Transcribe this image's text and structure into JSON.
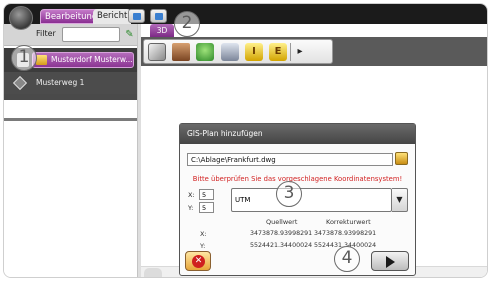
{
  "tabs": {
    "active": "Bearbeitung",
    "other": "Bericht"
  },
  "left_panel": {
    "filter_label": "Filter",
    "filter_value": "",
    "tree_items": [
      {
        "label": "Musterdorf Musterw..."
      },
      {
        "label": "Musterweg 1"
      }
    ]
  },
  "toolbar": {
    "view_tab_label": "3D",
    "buttons": [
      {
        "icon": "cube-icon"
      },
      {
        "icon": "layers-icon"
      },
      {
        "icon": "leaf-icon"
      },
      {
        "icon": "gray-stack-icon"
      },
      {
        "icon": "i-icon",
        "text": "I"
      },
      {
        "icon": "e-icon",
        "text": "E"
      }
    ],
    "more_arrow": "▸"
  },
  "dialog": {
    "title": "GIS-Plan hinzufügen",
    "path": "C:\\Ablage\\Frankfurt.dwg",
    "warning": "Bitte überprüfen Sie das vorgeschlagene Koordinatensystem!",
    "x_label": "X:",
    "x_value": "5",
    "y_label": "Y:",
    "y_value": "5",
    "crs_selected": "UTM",
    "columns": {
      "source": "Quellwert",
      "corrected": "Korrekturwert"
    },
    "rows": [
      {
        "label": "X:",
        "source": "3473878.93998291",
        "corrected": "3473878.93998291"
      },
      {
        "label": "Y:",
        "source": "5524421.34400024",
        "corrected": "5524431.34400024"
      }
    ]
  },
  "callouts": [
    "1",
    "2",
    "3",
    "4"
  ]
}
